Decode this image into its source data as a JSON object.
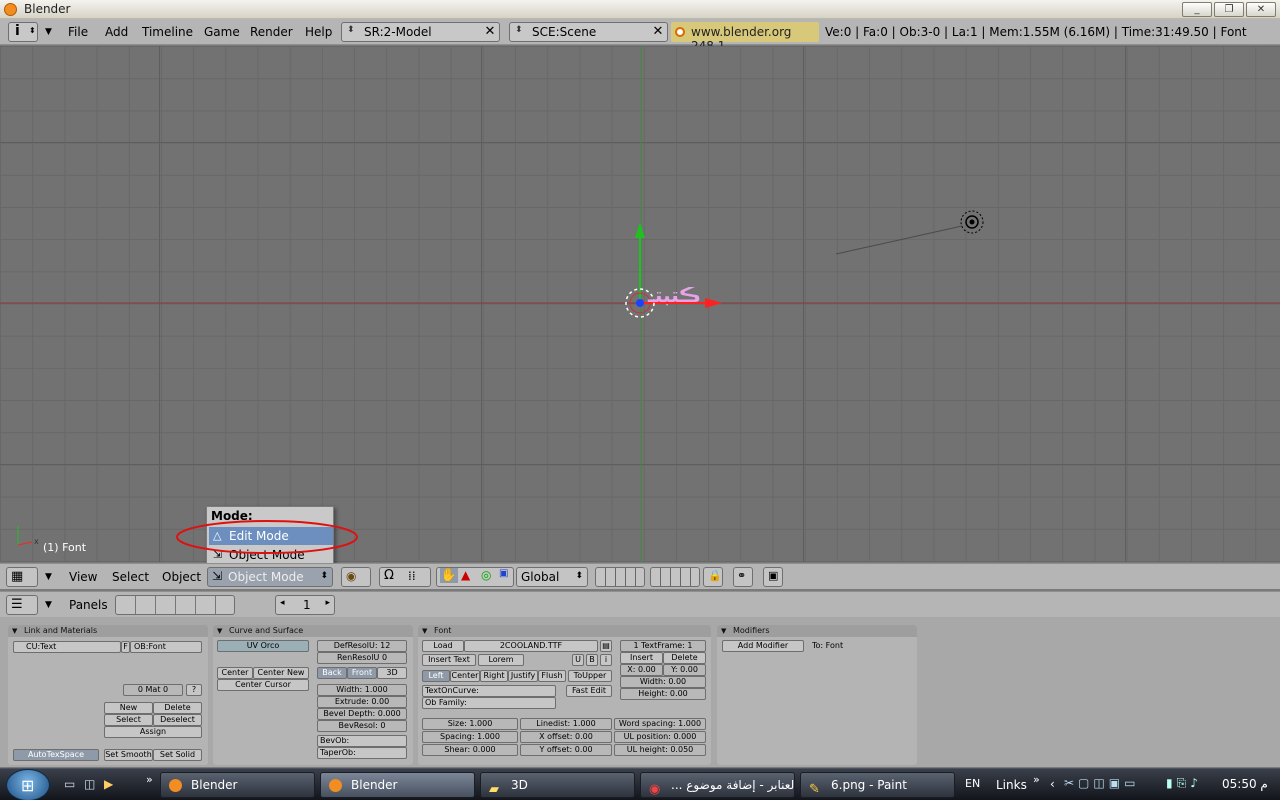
{
  "window": {
    "title": "Blender",
    "min": "_",
    "max": "❐",
    "close": "✕"
  },
  "topbar": {
    "menus": [
      "File",
      "Add",
      "Timeline",
      "Game",
      "Render",
      "Help"
    ],
    "screen_field": "SR:2-Model",
    "scene_field": "SCE:Scene",
    "brand": "www.blender.org 248.1",
    "stats": "Ve:0 | Fa:0 | Ob:3-0 | La:1  | Mem:1.55M (6.16M)  | Time:31:49.50 | Font"
  },
  "viewport": {
    "object_text": "ڪتبتـ",
    "status": "(1) Font",
    "axis_x": "x",
    "axis_y": "y"
  },
  "mode_menu": {
    "title": "Mode:",
    "items": [
      "Edit Mode",
      "Object Mode"
    ],
    "highlighted": "Edit Mode"
  },
  "vpheader": {
    "menus": [
      "View",
      "Select",
      "Object"
    ],
    "mode_value": "Object Mode",
    "orientation": "Global"
  },
  "btnheader": {
    "label": "Panels",
    "page": "1"
  },
  "panels": {
    "link": {
      "title": "Link and Materials",
      "cu": "CU:Text",
      "f": "F",
      "ob": "OB:Font",
      "mat": "0 Mat 0",
      "q": "?",
      "new": "New",
      "delete": "Delete",
      "select": "Select",
      "deselect": "Deselect",
      "assign": "Assign",
      "autotex": "AutoTexSpace",
      "setsmooth": "Set Smooth",
      "setsolid": "Set Solid"
    },
    "curve": {
      "title": "Curve and Surface",
      "uvorco": "UV Orco",
      "defresol": "DefResolU: 12",
      "renresol": "RenResolU 0",
      "center": "Center",
      "centernew": "Center New",
      "centercursor": "Center Cursor",
      "back": "Back",
      "front": "Front",
      "d3": "3D",
      "width": "Width: 1.000",
      "extrude": "Extrude: 0.00",
      "beveldepth": "Bevel Depth: 0.000",
      "bevresol": "BevResol: 0",
      "bevob": "BevOb:",
      "taperob": "TaperOb:"
    },
    "font": {
      "title": "Font",
      "load": "Load",
      "fontname": "2COOLAND.TTF",
      "inserttext": "Insert Text",
      "lorem": "Lorem",
      "u": "U",
      "b": "B",
      "i": "i",
      "left": "Left",
      "center": "Center",
      "right": "Right",
      "justify": "Justify",
      "flush": "Flush",
      "toupper": "ToUpper",
      "textoncurve": "TextOnCurve:",
      "fastedit": "Fast Edit",
      "obfamily": "Ob Family:",
      "textframe": "1 TextFrame: 1",
      "insert": "Insert",
      "delete": "Delete",
      "x": "X: 0.00",
      "y": "Y: 0.00",
      "width": "Width: 0.00",
      "height": "Height: 0.00",
      "size": "Size: 1.000",
      "linedist": "Linedist: 1.000",
      "wordspacing": "Word spacing: 1.000",
      "spacing": "Spacing: 1.000",
      "xoffset": "X offset: 0.00",
      "ulposition": "UL position: 0.000",
      "shear": "Shear: 0.000",
      "yoffset": "Y offset: 0.00",
      "ulheight": "UL height: 0.050"
    },
    "modifiers": {
      "title": "Modifiers",
      "add": "Add Modifier",
      "to": "To: Font"
    }
  },
  "taskbar": {
    "items": [
      "Blender",
      "Blender",
      "3D",
      "... العنابر - إضافة موضوع",
      "6.png - Paint"
    ],
    "lang": "EN",
    "links": "Links",
    "clock": "05:50 م"
  },
  "colors": {
    "x_axis": "#ff2020",
    "y_axis": "#1fc01f",
    "selected": "#e8a2e8",
    "highlight": "#6d8fbf"
  }
}
